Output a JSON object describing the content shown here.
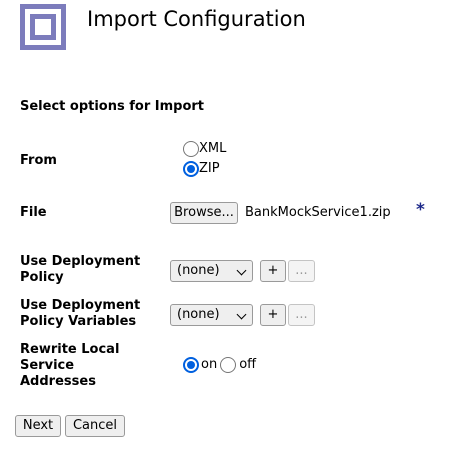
{
  "header": {
    "title": "Import Configuration",
    "logo_icon": "concentric-squares-icon",
    "brand_color": "#7c7cbc"
  },
  "form": {
    "section_heading": "Select options for Import",
    "from": {
      "label": "From",
      "options": [
        {
          "label": "XML",
          "checked": false
        },
        {
          "label": "ZIP",
          "checked": true
        }
      ]
    },
    "file": {
      "label": "File",
      "browse_label": "Browse...",
      "file_name": "BankMockService1.zip",
      "required_marker": "*"
    },
    "deployment_policy": {
      "label": "Use Deployment Policy",
      "selected": "(none)",
      "add_label": "+",
      "more_label": "..."
    },
    "deployment_policy_variables": {
      "label": "Use Deployment Policy Variables",
      "selected": "(none)",
      "add_label": "+",
      "more_label": "..."
    },
    "rewrite_local": {
      "label": "Rewrite Local Service Addresses",
      "options": [
        {
          "label": "on",
          "checked": true
        },
        {
          "label": "off",
          "checked": false
        }
      ]
    }
  },
  "actions": {
    "next_label": "Next",
    "cancel_label": "Cancel"
  },
  "colors": {
    "radio_checked": "#0060df",
    "required_marker": "#1e2a8a"
  }
}
